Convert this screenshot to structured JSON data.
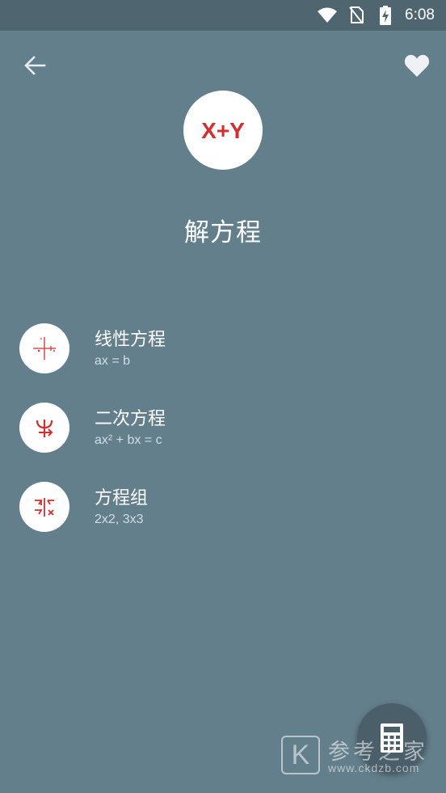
{
  "status_bar": {
    "time": "6:08",
    "icons": [
      "wifi-icon",
      "no-sim-icon",
      "battery-charging-icon"
    ]
  },
  "app_bar": {
    "back_icon": "arrow-left-icon",
    "favorite_icon": "heart-icon"
  },
  "header": {
    "logo_text": "X+Y",
    "title": "解方程"
  },
  "items": [
    {
      "title": "线性方程",
      "subtitle": "ax = b",
      "icon": "linear-graph-icon"
    },
    {
      "title": "二次方程",
      "subtitle": "ax² + bx = c",
      "icon": "quadratic-icon"
    },
    {
      "title": "方程组",
      "subtitle": "2x2, 3x3",
      "icon": "equation-system-icon"
    }
  ],
  "fab": {
    "icon": "calculator-icon"
  },
  "watermark": {
    "logo_letter": "K",
    "text": "参考之家",
    "url": "www.ckdzb.com"
  },
  "colors": {
    "background": "#647f8c",
    "status_bar": "#4f6570",
    "accent_red": "#d32f2f",
    "fab": "#4a5f69"
  }
}
